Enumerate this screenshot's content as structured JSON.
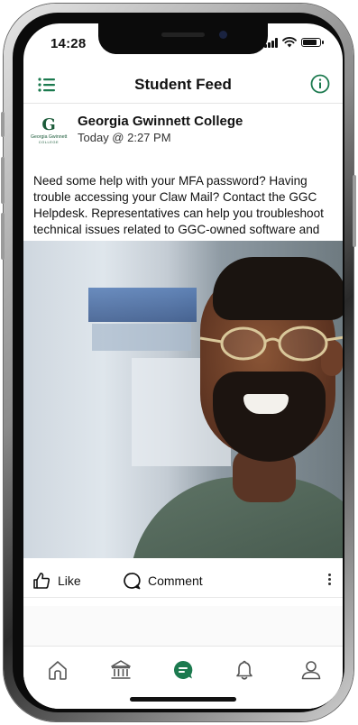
{
  "status_bar": {
    "time": "14:28"
  },
  "header": {
    "title": "Student Feed",
    "menu_icon": "list-menu-icon",
    "info_icon": "info-circle-icon"
  },
  "post": {
    "author": "Georgia Gwinnett College",
    "timestamp": "Today @ 2:27 PM",
    "logo": {
      "letter": "G",
      "line1": "Georgia Gwinnett",
      "line2": "COLLEGE"
    },
    "text": "Need some help with your MFA password? Having trouble accessing your Claw Mail? Contact the GGC Helpdesk. Representatives can help you troubleshoot technical issues related to GGC-owned software and hardware devices.",
    "actions": {
      "like_label": "Like",
      "comment_label": "Comment"
    }
  },
  "bottom_nav": {
    "items": [
      {
        "icon": "home-icon",
        "active": false
      },
      {
        "icon": "institution-icon",
        "active": false
      },
      {
        "icon": "chat-icon",
        "active": true
      },
      {
        "icon": "bell-icon",
        "active": false
      },
      {
        "icon": "user-icon",
        "active": false
      }
    ]
  },
  "colors": {
    "accent": "#1c7a4f",
    "text": "#111111",
    "divider": "#e4e4e4"
  }
}
